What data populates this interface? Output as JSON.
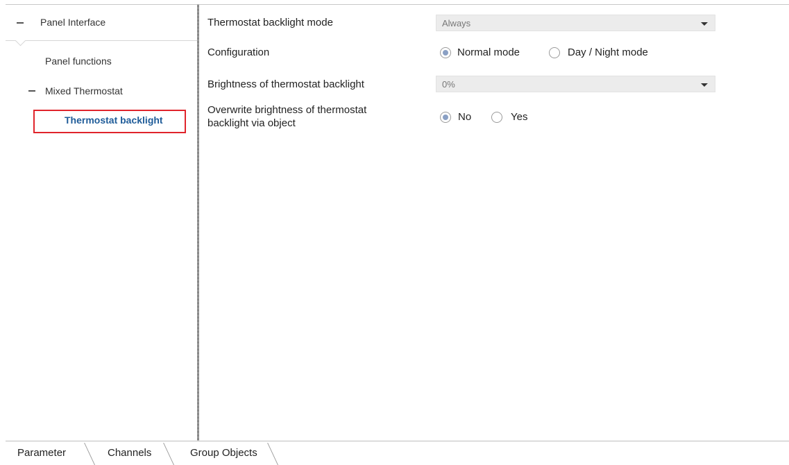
{
  "sidebar": {
    "header_label": "Panel Interface",
    "items": [
      {
        "label": "Panel functions"
      },
      {
        "label": "Mixed Thermostat"
      },
      {
        "label": "Thermostat backlight"
      }
    ]
  },
  "params": {
    "backlight_mode": {
      "label": "Thermostat backlight mode",
      "value": "Always"
    },
    "configuration": {
      "label": "Configuration",
      "options": [
        "Normal mode",
        "Day / Night mode"
      ],
      "selected": "Normal mode"
    },
    "brightness": {
      "label": "Brightness of thermostat backlight",
      "value": "0%"
    },
    "overwrite": {
      "label_line1": "Overwrite brightness of thermostat",
      "label_line2": "backlight  via object",
      "options": [
        "No",
        "Yes"
      ],
      "selected": "No"
    }
  },
  "tabs": [
    "Parameter",
    "Channels",
    "Group Objects"
  ],
  "colors": {
    "selected_text": "#1f5c99",
    "highlight_border": "#e0242b",
    "radio_dot": "#8aa0c4"
  }
}
